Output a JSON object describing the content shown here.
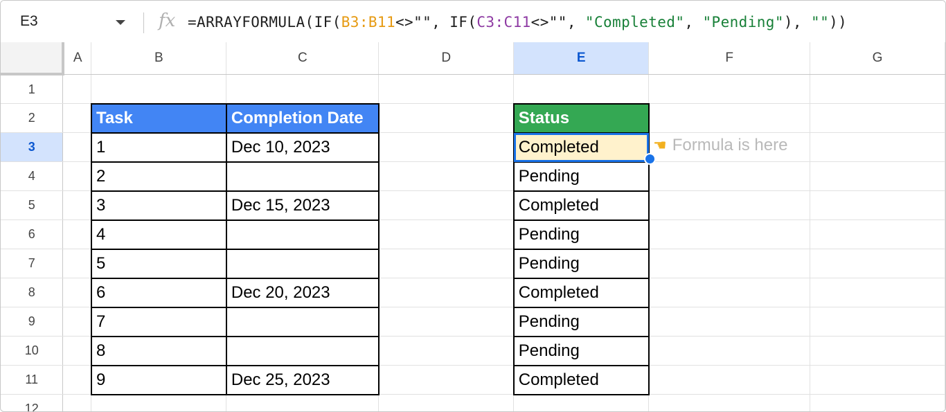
{
  "formula_bar": {
    "name_box": "E3",
    "fx_label": "fx",
    "formula_parts": [
      {
        "text": "=ARRAYFORMULA(IF(",
        "color": "default"
      },
      {
        "text": "B3:B11",
        "color": "orange"
      },
      {
        "text": "<>\"\", IF(",
        "color": "default"
      },
      {
        "text": "C3:C11",
        "color": "purple"
      },
      {
        "text": "<>\"\", ",
        "color": "default"
      },
      {
        "text": "\"Completed\"",
        "color": "green"
      },
      {
        "text": ", ",
        "color": "default"
      },
      {
        "text": "\"Pending\"",
        "color": "green"
      },
      {
        "text": "), ",
        "color": "default"
      },
      {
        "text": "\"\"",
        "color": "green"
      },
      {
        "text": "))",
        "color": "default"
      }
    ]
  },
  "columns": [
    "A",
    "B",
    "C",
    "D",
    "E",
    "F",
    "G"
  ],
  "selected_column": "E",
  "rows": [
    "1",
    "2",
    "3",
    "4",
    "5",
    "6",
    "7",
    "8",
    "9",
    "10",
    "11",
    "12"
  ],
  "selected_row": "3",
  "table_headers": {
    "task": "Task",
    "completion_date": "Completion Date",
    "status": "Status"
  },
  "tasks": [
    "1",
    "2",
    "3",
    "4",
    "5",
    "6",
    "7",
    "8",
    "9"
  ],
  "completion_dates": [
    "Dec 10, 2023",
    "",
    "Dec 15, 2023",
    "",
    "",
    "Dec 20, 2023",
    "",
    "",
    "Dec 25, 2023"
  ],
  "statuses": [
    "Completed",
    "Pending",
    "Completed",
    "Pending",
    "Pending",
    "Completed",
    "Pending",
    "Pending",
    "Completed"
  ],
  "annotation": {
    "icon": "pointing-hand-icon",
    "text": "Formula is here"
  },
  "colors": {
    "header_blue": "#4285f4",
    "header_green": "#34a853",
    "active_cell_fill": "#fff2cc",
    "selection_blue": "#1a73e8",
    "range_orange": "#e69a12",
    "range_purple": "#8e3aa3",
    "string_green": "#188038"
  }
}
